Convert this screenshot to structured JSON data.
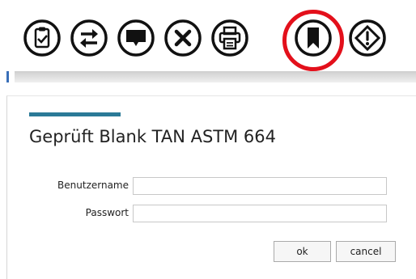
{
  "toolbar": {
    "buttons": [
      {
        "name": "clipboard-check-icon"
      },
      {
        "name": "swap-arrows-icon"
      },
      {
        "name": "comment-icon"
      },
      {
        "name": "cancel-x-icon"
      },
      {
        "name": "print-icon"
      },
      {
        "name": "bookmark-icon",
        "highlighted": true
      },
      {
        "name": "warning-diamond-icon"
      }
    ],
    "highlight_color": "#e3101b"
  },
  "dialog": {
    "title": "Geprüft Blank TAN ASTM 664",
    "accent_color": "#2b7a97",
    "username_label": "Benutzername",
    "username_value": "",
    "password_label": "Passwort",
    "password_value": "",
    "ok_label": "ok",
    "cancel_label": "cancel"
  }
}
